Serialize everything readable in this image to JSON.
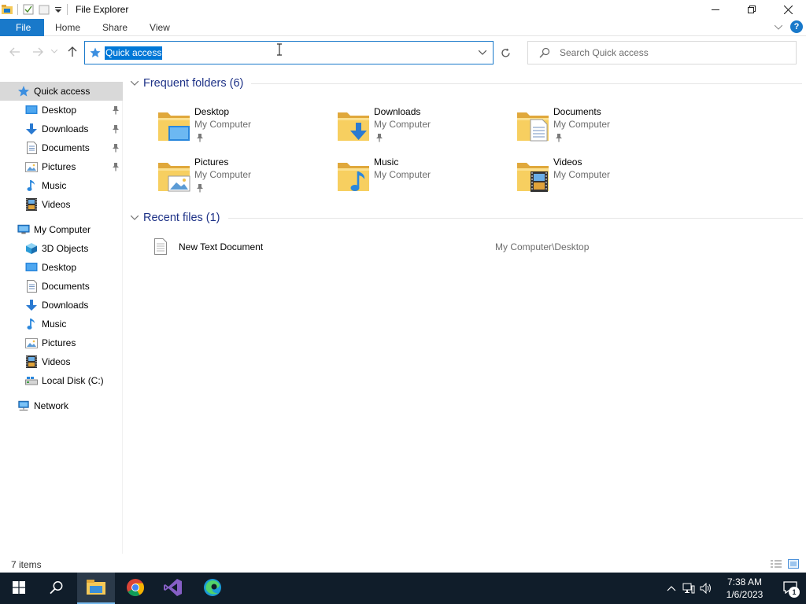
{
  "window": {
    "title": "File Explorer",
    "minimize": "—",
    "restore": "❐",
    "close": "✕"
  },
  "ribbon": {
    "tabs": [
      "File",
      "Home",
      "Share",
      "View"
    ],
    "help": "?"
  },
  "address": {
    "value": "Quick access"
  },
  "search": {
    "placeholder": "Search Quick access"
  },
  "sidebar": {
    "items": [
      {
        "label": "Quick access",
        "icon": "star-icon",
        "indent": 1,
        "active": true
      },
      {
        "label": "Desktop",
        "icon": "desktop-icon",
        "indent": 2,
        "pinned": true
      },
      {
        "label": "Downloads",
        "icon": "download-icon",
        "indent": 2,
        "pinned": true
      },
      {
        "label": "Documents",
        "icon": "documents-icon",
        "indent": 2,
        "pinned": true
      },
      {
        "label": "Pictures",
        "icon": "pictures-icon",
        "indent": 2,
        "pinned": true
      },
      {
        "label": "Music",
        "icon": "music-icon",
        "indent": 2
      },
      {
        "label": "Videos",
        "icon": "videos-icon",
        "indent": 2
      },
      {
        "label": "My Computer",
        "icon": "computer-icon",
        "indent": 1
      },
      {
        "label": "3D Objects",
        "icon": "cube-icon",
        "indent": 2
      },
      {
        "label": "Desktop",
        "icon": "desktop-icon",
        "indent": 2
      },
      {
        "label": "Documents",
        "icon": "documents-icon",
        "indent": 2
      },
      {
        "label": "Downloads",
        "icon": "download-icon",
        "indent": 2
      },
      {
        "label": "Music",
        "icon": "music-icon",
        "indent": 2
      },
      {
        "label": "Pictures",
        "icon": "pictures-icon",
        "indent": 2
      },
      {
        "label": "Videos",
        "icon": "videos-icon",
        "indent": 2
      },
      {
        "label": "Local Disk (C:)",
        "icon": "drive-icon",
        "indent": 2
      },
      {
        "label": "Network",
        "icon": "network-icon",
        "indent": 1
      }
    ]
  },
  "frequent": {
    "heading": "Frequent folders (6)",
    "folders": [
      {
        "name": "Desktop",
        "location": "My Computer",
        "pinned": true,
        "icon": "desktop-folder-icon"
      },
      {
        "name": "Downloads",
        "location": "My Computer",
        "pinned": true,
        "icon": "downloads-folder-icon"
      },
      {
        "name": "Documents",
        "location": "My Computer",
        "pinned": true,
        "icon": "documents-folder-icon"
      },
      {
        "name": "Pictures",
        "location": "My Computer",
        "pinned": true,
        "icon": "pictures-folder-icon"
      },
      {
        "name": "Music",
        "location": "My Computer",
        "pinned": false,
        "icon": "music-folder-icon"
      },
      {
        "name": "Videos",
        "location": "My Computer",
        "pinned": false,
        "icon": "videos-folder-icon"
      }
    ]
  },
  "recent": {
    "heading": "Recent files (1)",
    "files": [
      {
        "name": "New Text Document",
        "path": "My Computer\\Desktop"
      }
    ]
  },
  "status": {
    "item_count": "7 items"
  },
  "taskbar": {
    "apps": [
      "windows-start-icon",
      "search-icon",
      "file-explorer-icon",
      "chrome-icon",
      "visual-studio-icon",
      "edge-icon"
    ],
    "time": "7:38 AM",
    "date": "1/6/2023",
    "notification_count": "1"
  },
  "colors": {
    "accent": "#1979ca",
    "selection": "#0078d7",
    "group_heading": "#1e3287",
    "taskbar": "#101d2a",
    "folder": "#f5c958"
  }
}
